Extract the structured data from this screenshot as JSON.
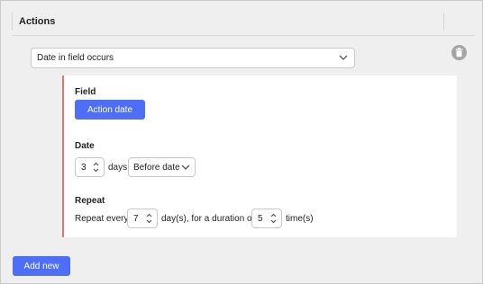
{
  "header": {
    "title": "Actions"
  },
  "trigger": {
    "value": "Date in field occurs",
    "chevron_icon": "chevron-down-icon"
  },
  "delete_icon": "trash-icon",
  "field_section": {
    "label": "Field",
    "button_label": "Action date"
  },
  "date_section": {
    "label": "Date",
    "offset_value": "3",
    "unit_text": "days",
    "relation_value": "Before date"
  },
  "repeat_section": {
    "label": "Repeat",
    "prefix_text": "Repeat every",
    "interval_value": "7",
    "middle_text": "day(s), for a duration of",
    "count_value": "5",
    "suffix_text": "time(s)"
  },
  "add_new_label": "Add new",
  "colors": {
    "accent": "#4f6ef7",
    "card_border": "#e57373",
    "background": "#efefef"
  }
}
